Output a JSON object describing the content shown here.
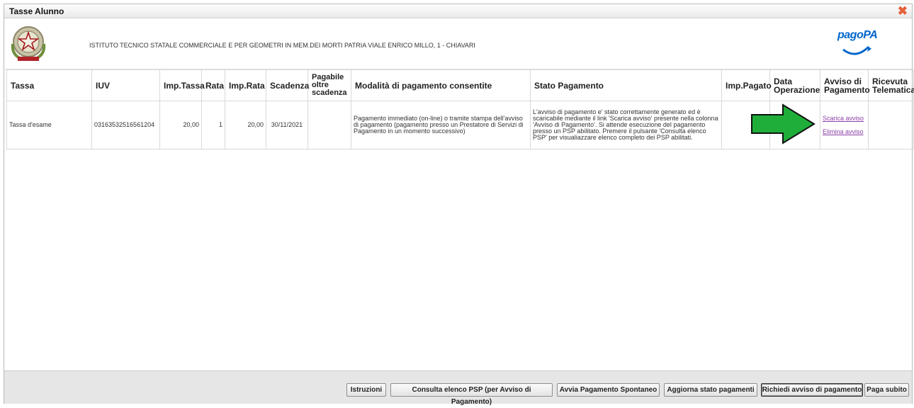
{
  "window": {
    "title": "Tasse Alunno",
    "close_icon": "close-icon"
  },
  "header": {
    "school": "ISTITUTO TECNICO STATALE COMMERCIALE E PER GEOMETRI IN MEM.DEI MORTI PATRIA VIALE ENRICO MILLO, 1 - CHIAVARI",
    "logo_text": "pagoPA"
  },
  "table": {
    "columns": [
      "Tassa",
      "IUV",
      "Imp.Tassa",
      "Rata",
      "Imp.Rata",
      "Scadenza",
      "Pagabile oltre scadenza",
      "Modalità di pagamento consentite",
      "Stato Pagamento",
      "Imp.Pagato",
      "Data Operazione",
      "Avviso di Pagamento",
      "Ricevuta Telematica"
    ],
    "rows": [
      {
        "tassa": "Tassa d'esame",
        "iuv": "03163532516561204",
        "imp_tassa": "20,00",
        "rata": "1",
        "imp_rata": "20,00",
        "scadenza": "30/11/2021",
        "pagabile": "",
        "modalita": "Pagamento immediato (on-line) o tramite stampa dell'avviso di pagamento (pagamento presso un Prestatore di Servizi di Pagamento in un momento successivo)",
        "stato": "L'avviso di pagamento e' stato correttamente generato ed è scaricabile mediante il link 'Scarica avviso' presente nella colonna 'Avviso di Pagamento'. Si attende esecuzione del pagamento presso un PSP abilitato. Premere il pulsante 'Consulta elenco PSP' per visualiazzare elenco completo dei PSP abilitati.",
        "imp_pagato": "",
        "data_operazione": "",
        "avviso_links": [
          "Scarica avviso",
          "Elimina avviso"
        ],
        "ricevuta": ""
      }
    ]
  },
  "footer": {
    "buttons": [
      "Istruzioni",
      "Consulta elenco PSP (per Avviso di Pagamento)",
      "Avvia Pagamento Spontaneo",
      "Aggiorna stato pagamenti",
      "Richiedi avviso di pagamento",
      "Paga subito"
    ]
  },
  "colors": {
    "arrow": "#1fae3a",
    "link": "#8b3fa6",
    "close": "#e5623a",
    "pagopa": "#0066cc"
  }
}
